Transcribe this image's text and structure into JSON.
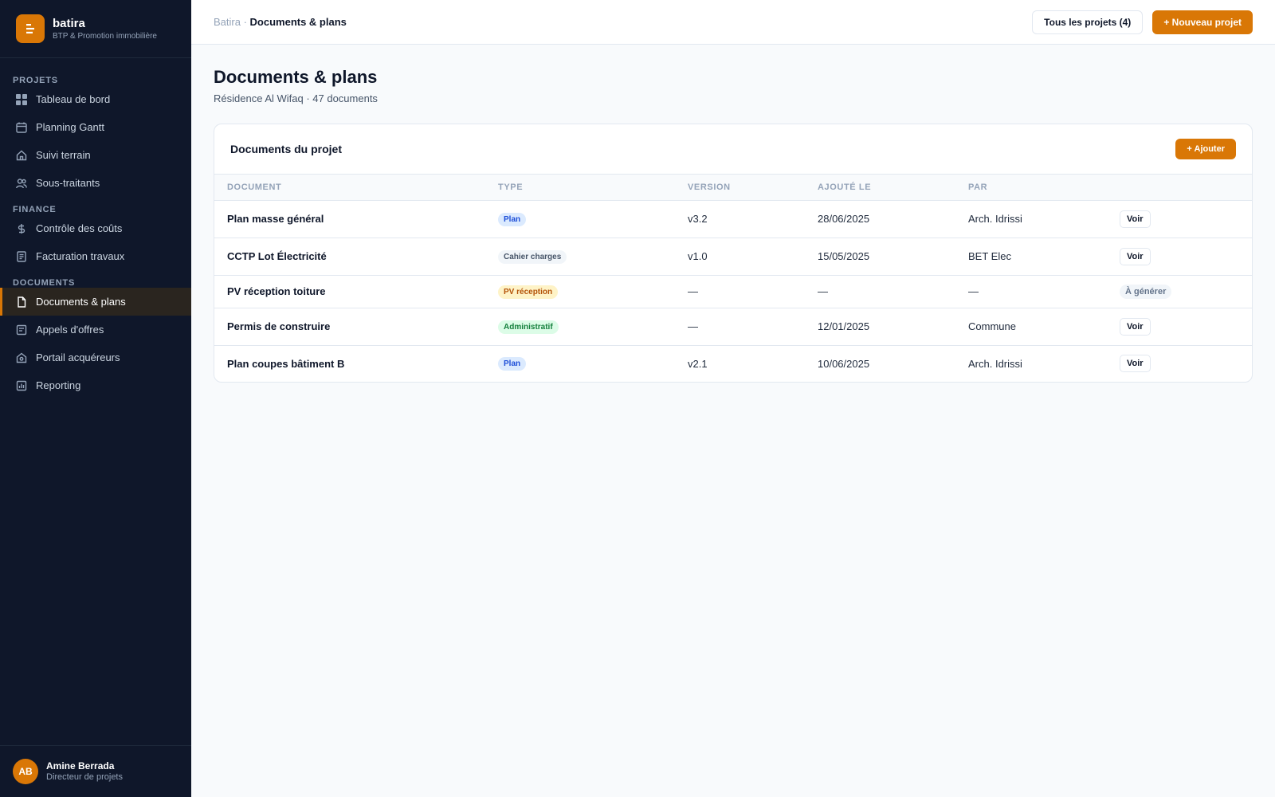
{
  "brand": {
    "name": "batira",
    "subtitle": "BTP & Promotion immobilière"
  },
  "sidebar": {
    "sections": [
      {
        "label": "PROJETS",
        "items": [
          {
            "label": "Tableau de bord",
            "icon": "grid-icon"
          },
          {
            "label": "Planning Gantt",
            "icon": "calendar-icon"
          },
          {
            "label": "Suivi terrain",
            "icon": "home-icon"
          },
          {
            "label": "Sous-traitants",
            "icon": "users-icon"
          }
        ]
      },
      {
        "label": "FINANCE",
        "items": [
          {
            "label": "Contrôle des coûts",
            "icon": "dollar-icon"
          },
          {
            "label": "Facturation travaux",
            "icon": "invoice-icon"
          }
        ]
      },
      {
        "label": "DOCUMENTS",
        "items": [
          {
            "label": "Documents & plans",
            "icon": "file-icon",
            "active": true
          },
          {
            "label": "Appels d'offres",
            "icon": "tender-icon"
          },
          {
            "label": "Portail acquéreurs",
            "icon": "portal-icon"
          },
          {
            "label": "Reporting",
            "icon": "chart-icon"
          }
        ]
      }
    ]
  },
  "user": {
    "initials": "AB",
    "name": "Amine Berrada",
    "role": "Directeur de projets"
  },
  "header": {
    "breadcrumb_root": "Batira",
    "breadcrumb_sep": " · ",
    "breadcrumb_current": "Documents & plans",
    "all_projects_label": "Tous les projets (4)",
    "new_project_label": "+ Nouveau projet"
  },
  "page": {
    "title": "Documents & plans",
    "subtitle": "Résidence Al Wifaq · 47 documents"
  },
  "card": {
    "title": "Documents du projet",
    "add_label": "+ Ajouter",
    "columns": [
      "DOCUMENT",
      "TYPE",
      "VERSION",
      "AJOUTÉ LE",
      "PAR",
      ""
    ],
    "rows": [
      {
        "document": "Plan masse général",
        "type": "Plan",
        "version": "v3.2",
        "added": "28/06/2025",
        "by": "Arch. Idrissi",
        "action": "Voir"
      },
      {
        "document": "CCTP Lot Électricité",
        "type": "Cahier charges",
        "version": "v1.0",
        "added": "15/05/2025",
        "by": "BET Elec",
        "action": "Voir"
      },
      {
        "document": "PV réception toiture",
        "type": "PV réception",
        "version": "—",
        "added": "—",
        "by": "—",
        "action": "À générer"
      },
      {
        "document": "Permis de construire",
        "type": "Administratif",
        "version": "—",
        "added": "12/01/2025",
        "by": "Commune",
        "action": "Voir"
      },
      {
        "document": "Plan coupes bâtiment B",
        "type": "Plan",
        "version": "v2.1",
        "added": "10/06/2025",
        "by": "Arch. Idrissi",
        "action": "Voir"
      }
    ]
  },
  "colors": {
    "accent": "#d97706",
    "sidebar_bg": "#0f172a"
  }
}
